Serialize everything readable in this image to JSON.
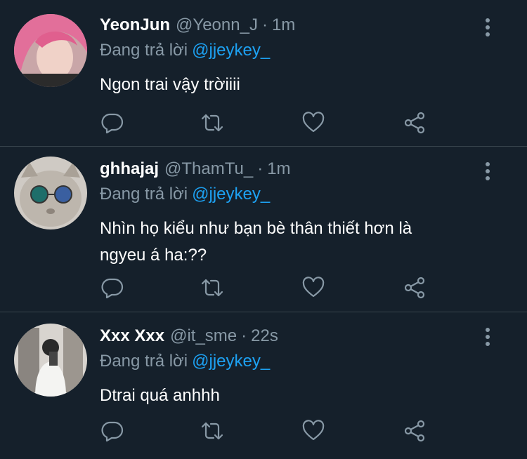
{
  "colors": {
    "background": "#15202b",
    "divider": "#38444d",
    "muted_text": "#8899a6",
    "link": "#1da1f2",
    "primary_text": "#ffffff"
  },
  "replies": [
    {
      "name": "YeonJun",
      "handle": "@Yeonn_J",
      "separator": "·",
      "time": "1m",
      "reply_prefix": "Đang trả lời",
      "reply_to": "@jjeykey_",
      "text": "Ngon trai vậy trờiiii",
      "avatar_icon": "avatar-pink-hair"
    },
    {
      "name": "ghhajaj",
      "handle": "@ThamTu_",
      "separator": "·",
      "time": "1m",
      "reply_prefix": "Đang trả lời",
      "reply_to": "@jjeykey_",
      "text_line1": "Nhìn họ kiểu như bạn bè thân thiết hơn là",
      "text_line2": "ngyeu á ha:??",
      "avatar_icon": "avatar-cat-sunglasses"
    },
    {
      "name": "Xxx Xxx",
      "handle": "@it_sme",
      "separator": "·",
      "time": "22s",
      "reply_prefix": "Đang trả lời",
      "reply_to": "@jjeykey_",
      "text": "Dtrai quá anhhh",
      "avatar_icon": "avatar-mirror-selfie"
    }
  ],
  "action_icons": [
    "reply-icon",
    "retweet-icon",
    "like-icon",
    "share-icon"
  ]
}
